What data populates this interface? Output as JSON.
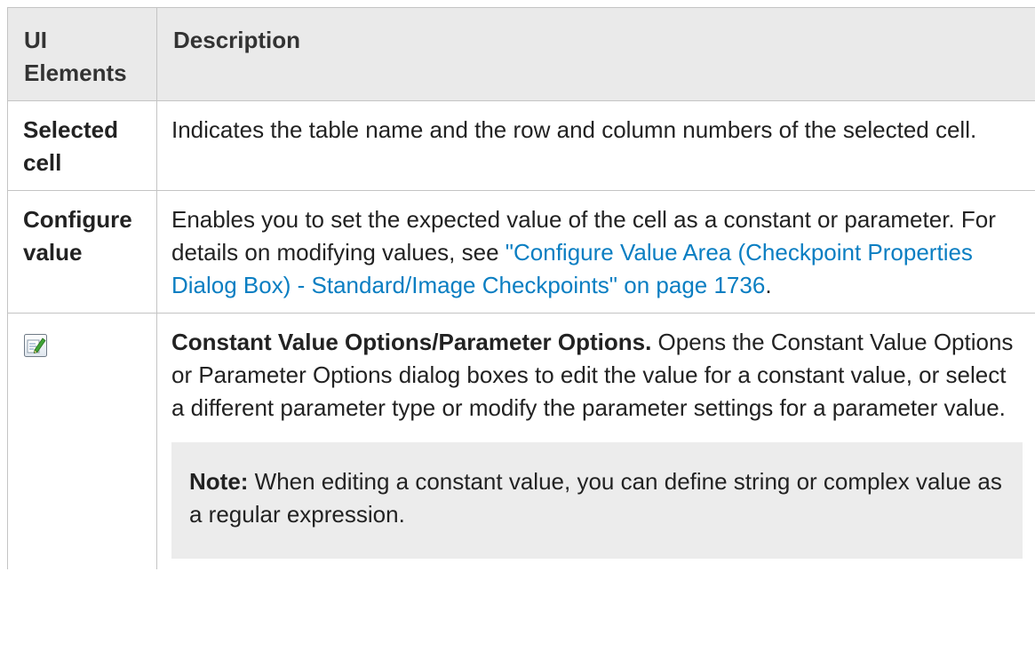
{
  "table": {
    "headers": [
      "UI Elements",
      "Description"
    ],
    "rows": [
      {
        "element": "Selected cell",
        "description": "Indicates the table name and the row and column numbers of the selected cell."
      },
      {
        "element": "Configure value",
        "description_prefix": "Enables you to set the expected value of the cell as a constant or parameter. For details on modifying values, see ",
        "link_text": "\"Configure Value Area (Checkpoint Properties Dialog Box) - Standard/Image Checkpoints\" on page 1736",
        "description_suffix": "."
      },
      {
        "element_icon": "edit-options-icon",
        "title": "Constant Value Options/Parameter Options.",
        "description": " Opens the Constant Value Options or Parameter Options dialog boxes to edit the value for a constant value, or select a different parameter type or modify the parameter settings for a parameter value.",
        "note_label": "Note:",
        "note_text": " When editing a constant value, you can define string or complex value as a regular expression."
      }
    ]
  },
  "colors": {
    "header_bg": "#eaeaea",
    "border": "#c4c4c4",
    "link": "#0a7ec2",
    "note_bg": "#ececec"
  }
}
